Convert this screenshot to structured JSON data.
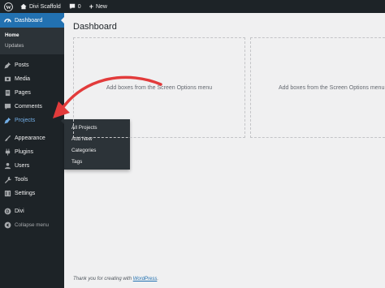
{
  "adminbar": {
    "site_name": "Divi Scaffold",
    "comments_count": "0",
    "new_label": "New"
  },
  "sidebar": {
    "dashboard_label": "Dashboard",
    "dashboard_sub": [
      "Home",
      "Updates"
    ],
    "items": [
      {
        "label": "Posts",
        "icon": "pin-icon"
      },
      {
        "label": "Media",
        "icon": "media-icon"
      },
      {
        "label": "Pages",
        "icon": "pages-icon"
      },
      {
        "label": "Comments",
        "icon": "comment-icon"
      },
      {
        "label": "Projects",
        "icon": "pin-icon"
      },
      {
        "label": "Appearance",
        "icon": "brush-icon"
      },
      {
        "label": "Plugins",
        "icon": "plugin-icon"
      },
      {
        "label": "Users",
        "icon": "user-icon"
      },
      {
        "label": "Tools",
        "icon": "wrench-icon"
      },
      {
        "label": "Settings",
        "icon": "settings-icon"
      },
      {
        "label": "Divi",
        "icon": "divi-icon"
      }
    ],
    "collapse_label": "Collapse menu"
  },
  "flyout": {
    "items": [
      "All Projects",
      "Add New",
      "Categories",
      "Tags"
    ]
  },
  "main": {
    "title": "Dashboard",
    "box_placeholder": "Add boxes from the Screen Options menu",
    "footer_text": "Thank you for creating with ",
    "footer_link": "WordPress",
    "footer_end": "."
  },
  "colors": {
    "adminbar_bg": "#1d2327",
    "accent": "#2271b1",
    "annotation_arrow": "#e23b3b"
  }
}
